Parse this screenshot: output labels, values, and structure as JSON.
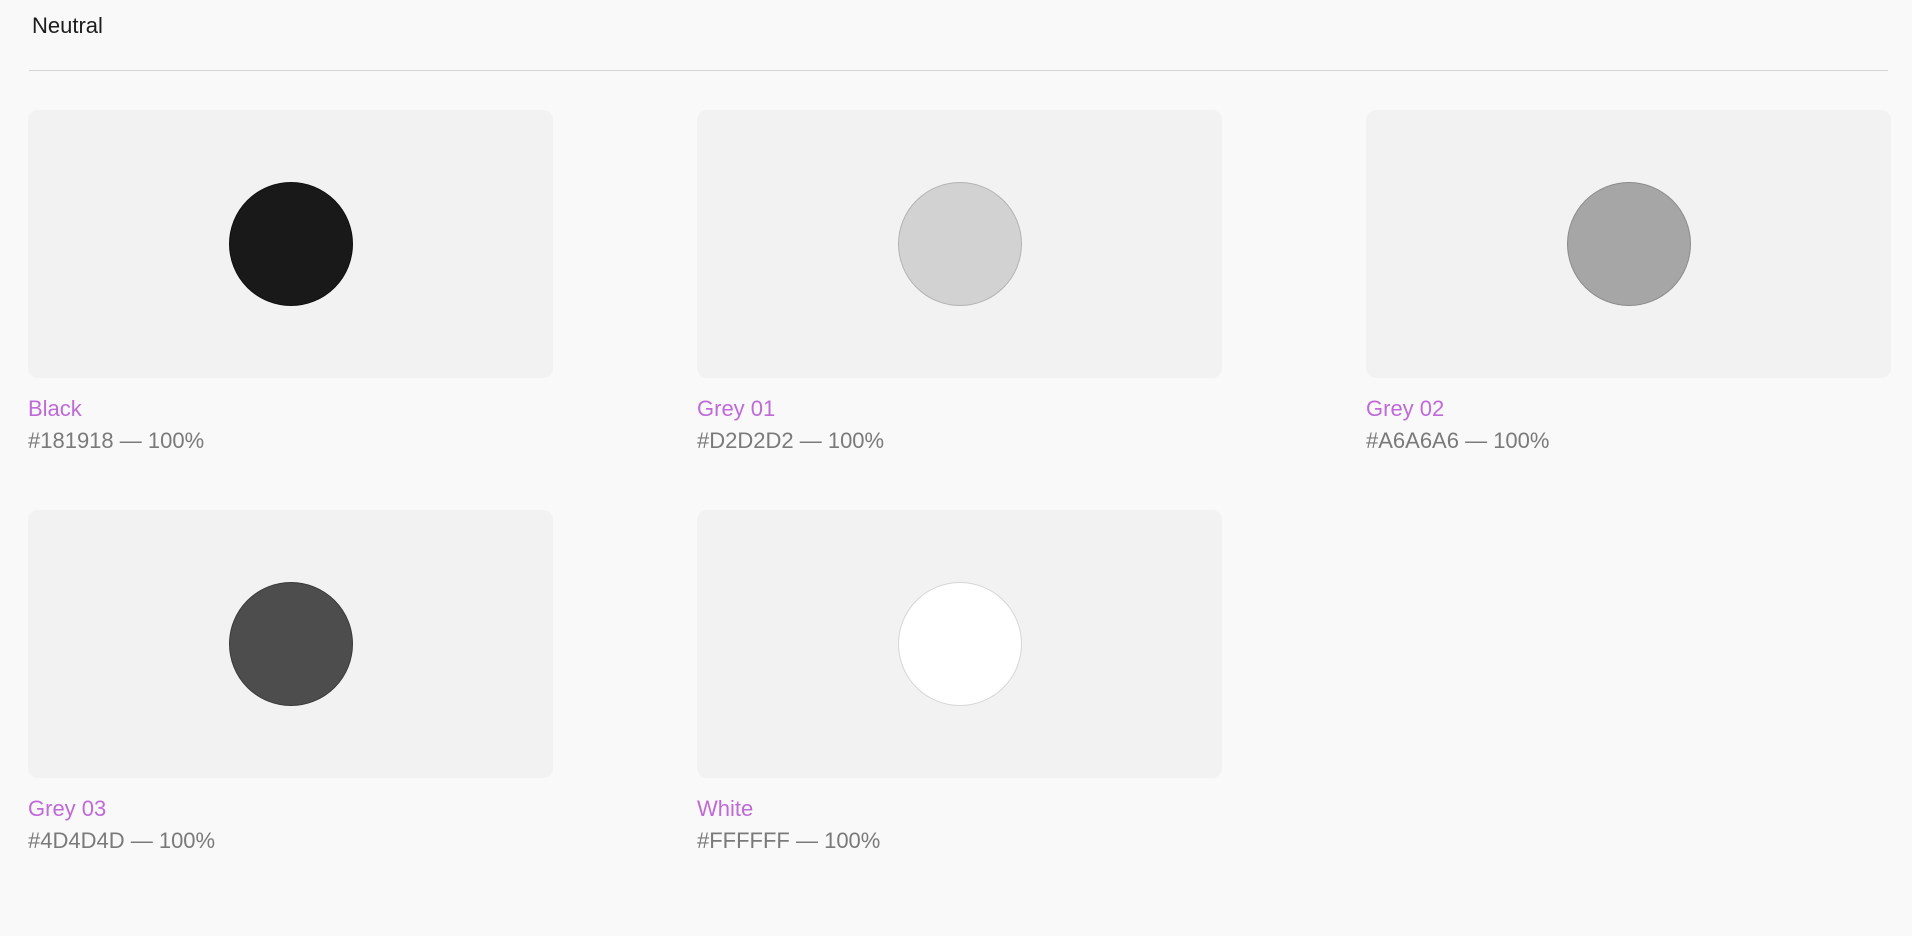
{
  "section": {
    "title": "Neutral"
  },
  "swatches": [
    {
      "name": "Black",
      "value": "#181918 — 100%",
      "color": "#181918",
      "border": "#0f0f0f"
    },
    {
      "name": "Grey 01",
      "value": "#D2D2D2 — 100%",
      "color": "#D2D2D2",
      "border": "#b3b3b3"
    },
    {
      "name": "Grey 02",
      "value": "#A6A6A6 — 100%",
      "color": "#A6A6A6",
      "border": "#8c8c8c"
    },
    {
      "name": "Grey 03",
      "value": "#4D4D4D — 100%",
      "color": "#4D4D4D",
      "border": "#3a3a3a"
    },
    {
      "name": "White",
      "value": "#FFFFFF — 100%",
      "color": "#FFFFFF",
      "border": "#d6d6d6"
    }
  ],
  "accent_color": "#C06AD8"
}
